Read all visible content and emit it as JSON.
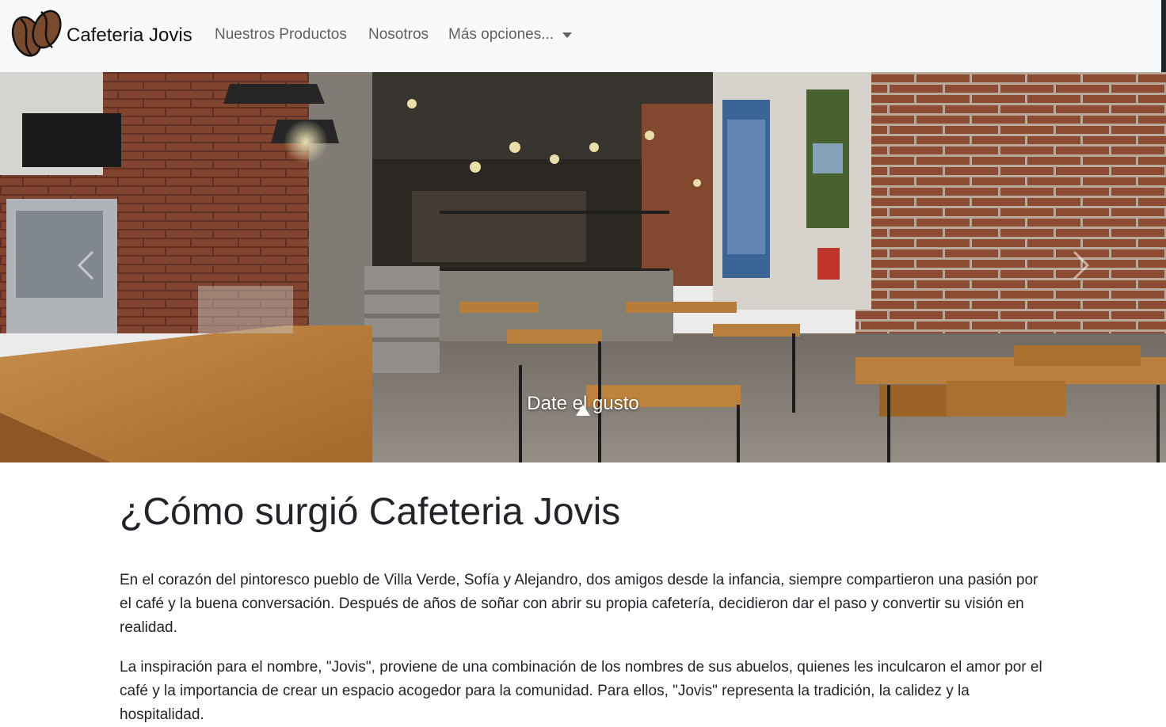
{
  "navbar": {
    "brand": "Cafeteria Jovis",
    "logo_icon": "coffee-beans-icon",
    "links": [
      "Nuestros Productos",
      "Nosotros"
    ],
    "dropdown_label": "Más opciones...",
    "dropdown_icon": "caret-down-icon"
  },
  "carousel": {
    "caption": "Date el gusto",
    "prev_icon": "chevron-left-icon",
    "next_icon": "chevron-right-icon"
  },
  "about": {
    "title": "¿Cómo surgió Cafeteria Jovis",
    "paragraphs": [
      "En el corazón del pintoresco pueblo de Villa Verde, Sofía y Alejandro, dos amigos desde la infancia, siempre compartieron una pasión por el café y la buena conversación. Después de años de soñar con abrir su propia cafetería, decidieron dar el paso y convertir su visión en realidad.",
      "La inspiración para el nombre, \"Jovis\", proviene de una combinación de los nombres de sus abuelos, quienes les inculcaron el amor por el café y la importancia de crear un espacio acogedor para la comunidad. Para ellos, \"Jovis\" representa la tradición, la calidez y la hospitalidad."
    ]
  },
  "colors": {
    "navbar_bg": "#f8f9fa",
    "text": "#212529",
    "brick": "#8a4a32",
    "wood": "#c9883e"
  }
}
